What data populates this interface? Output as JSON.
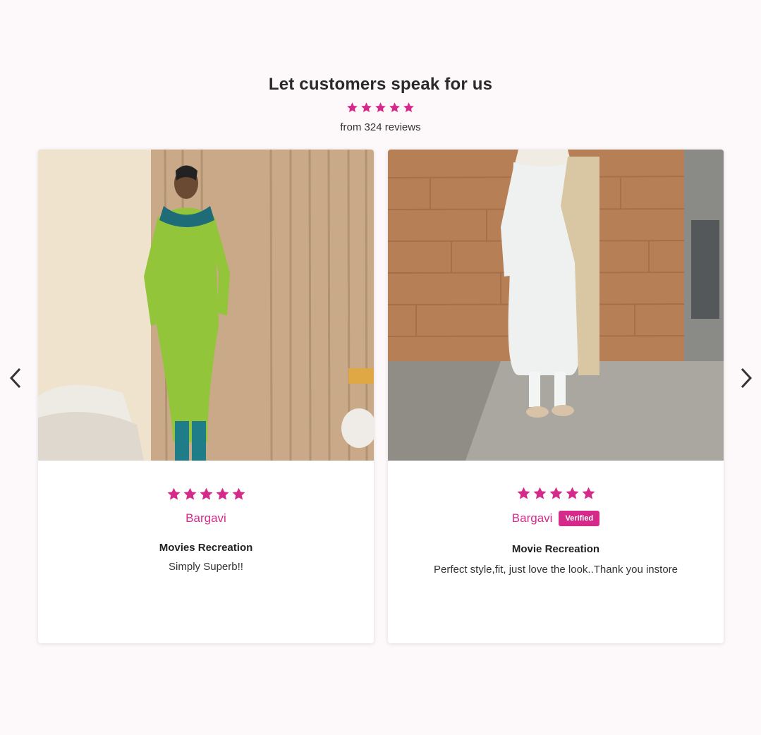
{
  "section": {
    "heading": "Let customers speak for us",
    "summary": {
      "rating_stars": 5,
      "count_text": "from 324 reviews"
    }
  },
  "colors": {
    "accent": "#d62a8b",
    "background": "#fdf9fb"
  },
  "carousel": {
    "prev_icon": "chevron-left-icon",
    "next_icon": "chevron-right-icon",
    "reviews": [
      {
        "rating": 5,
        "author": "Bargavi",
        "verified": false,
        "title": "Movies Recreation",
        "body": "Simply Superb!!",
        "photo": "customer-photo-green-kurta"
      },
      {
        "rating": 5,
        "author": "Bargavi",
        "verified": true,
        "badge_label": "Verified",
        "title": "Movie Recreation",
        "body": "Perfect style,fit, just love the look..Thank you instore",
        "photo": "customer-photo-white-kurta"
      }
    ]
  }
}
